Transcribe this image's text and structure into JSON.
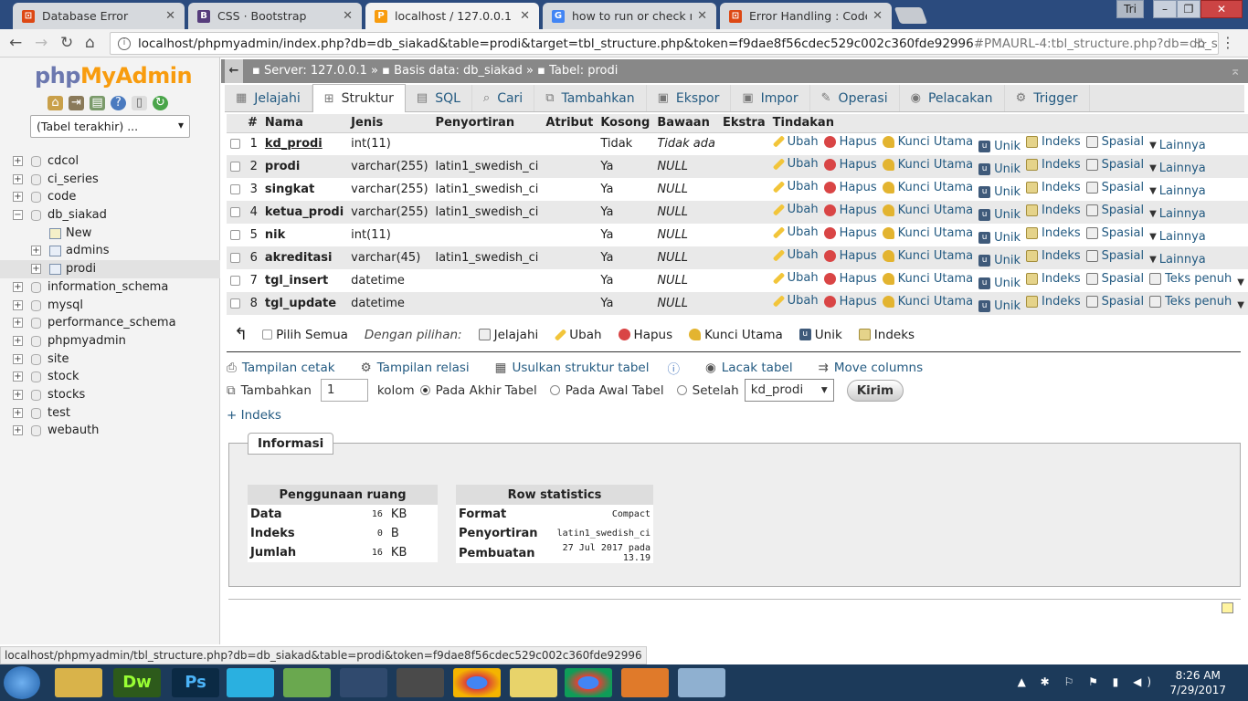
{
  "browser": {
    "tabs": [
      {
        "title": "Database Error",
        "icon": "codeigniter-icon",
        "active": false
      },
      {
        "title": "CSS · Bootstrap",
        "icon": "bootstrap-icon",
        "active": false
      },
      {
        "title": "localhost / 127.0.0.1 / db",
        "icon": "phpmyadmin-icon",
        "active": true
      },
      {
        "title": "how to run or check moc",
        "icon": "google-icon",
        "active": false
      },
      {
        "title": "Error Handling : CodeIgn",
        "icon": "codeigniter-icon",
        "active": false
      }
    ],
    "window_label": "Tri",
    "url_host": "localhost/phpmyadmin/index.php?db=db_siakad&table=prodi&target=tbl_structure.php&token=f9dae8f56cdec529c002c360fde92996",
    "url_hash": "#PMAURL-4:tbl_structure.php?db=db_siakad&ta"
  },
  "sidebar": {
    "logo_php": "php",
    "logo_my": "MyAdmin",
    "recent_select": "(Tabel terakhir) ...",
    "tree": [
      {
        "label": "cdcol",
        "type": "db",
        "level": 0
      },
      {
        "label": "ci_series",
        "type": "db",
        "level": 0
      },
      {
        "label": "code",
        "type": "db",
        "level": 0
      },
      {
        "label": "db_siakad",
        "type": "db",
        "level": 0,
        "expanded": true
      },
      {
        "label": "New",
        "type": "new",
        "level": 1
      },
      {
        "label": "admins",
        "type": "table",
        "level": 1
      },
      {
        "label": "prodi",
        "type": "table",
        "level": 1,
        "selected": true
      },
      {
        "label": "information_schema",
        "type": "db",
        "level": 0
      },
      {
        "label": "mysql",
        "type": "db",
        "level": 0
      },
      {
        "label": "performance_schema",
        "type": "db",
        "level": 0
      },
      {
        "label": "phpmyadmin",
        "type": "db",
        "level": 0
      },
      {
        "label": "site",
        "type": "db",
        "level": 0
      },
      {
        "label": "stock",
        "type": "db",
        "level": 0
      },
      {
        "label": "stocks",
        "type": "db",
        "level": 0
      },
      {
        "label": "test",
        "type": "db",
        "level": 0
      },
      {
        "label": "webauth",
        "type": "db",
        "level": 0
      }
    ]
  },
  "breadcrumb": {
    "server": "Server: 127.0.0.1",
    "database": "Basis data: db_siakad",
    "table": "Tabel: prodi"
  },
  "tabs": [
    {
      "label": "Jelajahi",
      "icon": "browse-icon"
    },
    {
      "label": "Struktur",
      "icon": "structure-icon",
      "active": true
    },
    {
      "label": "SQL",
      "icon": "sql-icon"
    },
    {
      "label": "Cari",
      "icon": "search-icon"
    },
    {
      "label": "Tambahkan",
      "icon": "insert-icon"
    },
    {
      "label": "Ekspor",
      "icon": "export-icon"
    },
    {
      "label": "Impor",
      "icon": "import-icon"
    },
    {
      "label": "Operasi",
      "icon": "wrench-icon"
    },
    {
      "label": "Pelacakan",
      "icon": "eye-icon"
    },
    {
      "label": "Trigger",
      "icon": "trigger-icon"
    }
  ],
  "structure": {
    "headers": [
      "#",
      "Nama",
      "Jenis",
      "Penyortiran",
      "Atribut",
      "Kosong",
      "Bawaan",
      "Ekstra",
      "Tindakan"
    ],
    "rows": [
      {
        "no": "1",
        "name": "kd_prodi",
        "type": "int(11)",
        "collation": "",
        "attr": "",
        "null": "Tidak",
        "default": "Tidak ada",
        "extra": "",
        "pk": true
      },
      {
        "no": "2",
        "name": "prodi",
        "type": "varchar(255)",
        "collation": "latin1_swedish_ci",
        "attr": "",
        "null": "Ya",
        "default": "NULL",
        "extra": ""
      },
      {
        "no": "3",
        "name": "singkat",
        "type": "varchar(255)",
        "collation": "latin1_swedish_ci",
        "attr": "",
        "null": "Ya",
        "default": "NULL",
        "extra": ""
      },
      {
        "no": "4",
        "name": "ketua_prodi",
        "type": "varchar(255)",
        "collation": "latin1_swedish_ci",
        "attr": "",
        "null": "Ya",
        "default": "NULL",
        "extra": ""
      },
      {
        "no": "5",
        "name": "nik",
        "type": "int(11)",
        "collation": "",
        "attr": "",
        "null": "Ya",
        "default": "NULL",
        "extra": ""
      },
      {
        "no": "6",
        "name": "akreditasi",
        "type": "varchar(45)",
        "collation": "latin1_swedish_ci",
        "attr": "",
        "null": "Ya",
        "default": "NULL",
        "extra": ""
      },
      {
        "no": "7",
        "name": "tgl_insert",
        "type": "datetime",
        "collation": "",
        "attr": "",
        "null": "Ya",
        "default": "NULL",
        "extra": "",
        "fulltext": true
      },
      {
        "no": "8",
        "name": "tgl_update",
        "type": "datetime",
        "collation": "",
        "attr": "",
        "null": "Ya",
        "default": "NULL",
        "extra": "",
        "fulltext": true
      }
    ],
    "actions": {
      "edit": "Ubah",
      "drop": "Hapus",
      "primary": "Kunci Utama",
      "unique": "Unik",
      "index": "Indeks",
      "spatial": "Spasial",
      "fulltext": "Teks penuh",
      "more": "Lainnya"
    }
  },
  "bulk": {
    "select_all": "Pilih Semua",
    "with_selected": "Dengan pilihan:",
    "browse": "Jelajahi",
    "edit": "Ubah",
    "drop": "Hapus",
    "primary": "Kunci Utama",
    "unique": "Unik",
    "index": "Indeks"
  },
  "links": {
    "print": "Tampilan cetak",
    "relation": "Tampilan relasi",
    "propose": "Usulkan struktur tabel",
    "track": "Lacak tabel",
    "move": "Move columns"
  },
  "add_columns": {
    "label": "Tambahkan",
    "count": "1",
    "kolom": "kolom",
    "at_end": "Pada Akhir Tabel",
    "at_begin": "Pada Awal Tabel",
    "after": "Setelah",
    "after_col": "kd_prodi",
    "submit": "Kirim"
  },
  "add_index": "+ Indeks",
  "info": {
    "legend": "Informasi",
    "space_title": "Penggunaan ruang",
    "space": [
      {
        "label": "Data",
        "value": "16",
        "unit": "KB"
      },
      {
        "label": "Indeks",
        "value": "0",
        "unit": "B"
      },
      {
        "label": "Jumlah",
        "value": "16",
        "unit": "KB"
      }
    ],
    "stats_title": "Row statistics",
    "stats": [
      {
        "label": "Format",
        "value": "Compact"
      },
      {
        "label": "Penyortiran",
        "value": "latin1_swedish_ci"
      },
      {
        "label": "Pembuatan",
        "value": "27 Jul 2017 pada 13.19"
      }
    ]
  },
  "statusbar": "localhost/phpmyadmin/tbl_structure.php?db=db_siakad&table=prodi&token=f9dae8f56cdec529c002c360fde92996",
  "clock": {
    "time": "8:26 AM",
    "date": "7/29/2017"
  }
}
